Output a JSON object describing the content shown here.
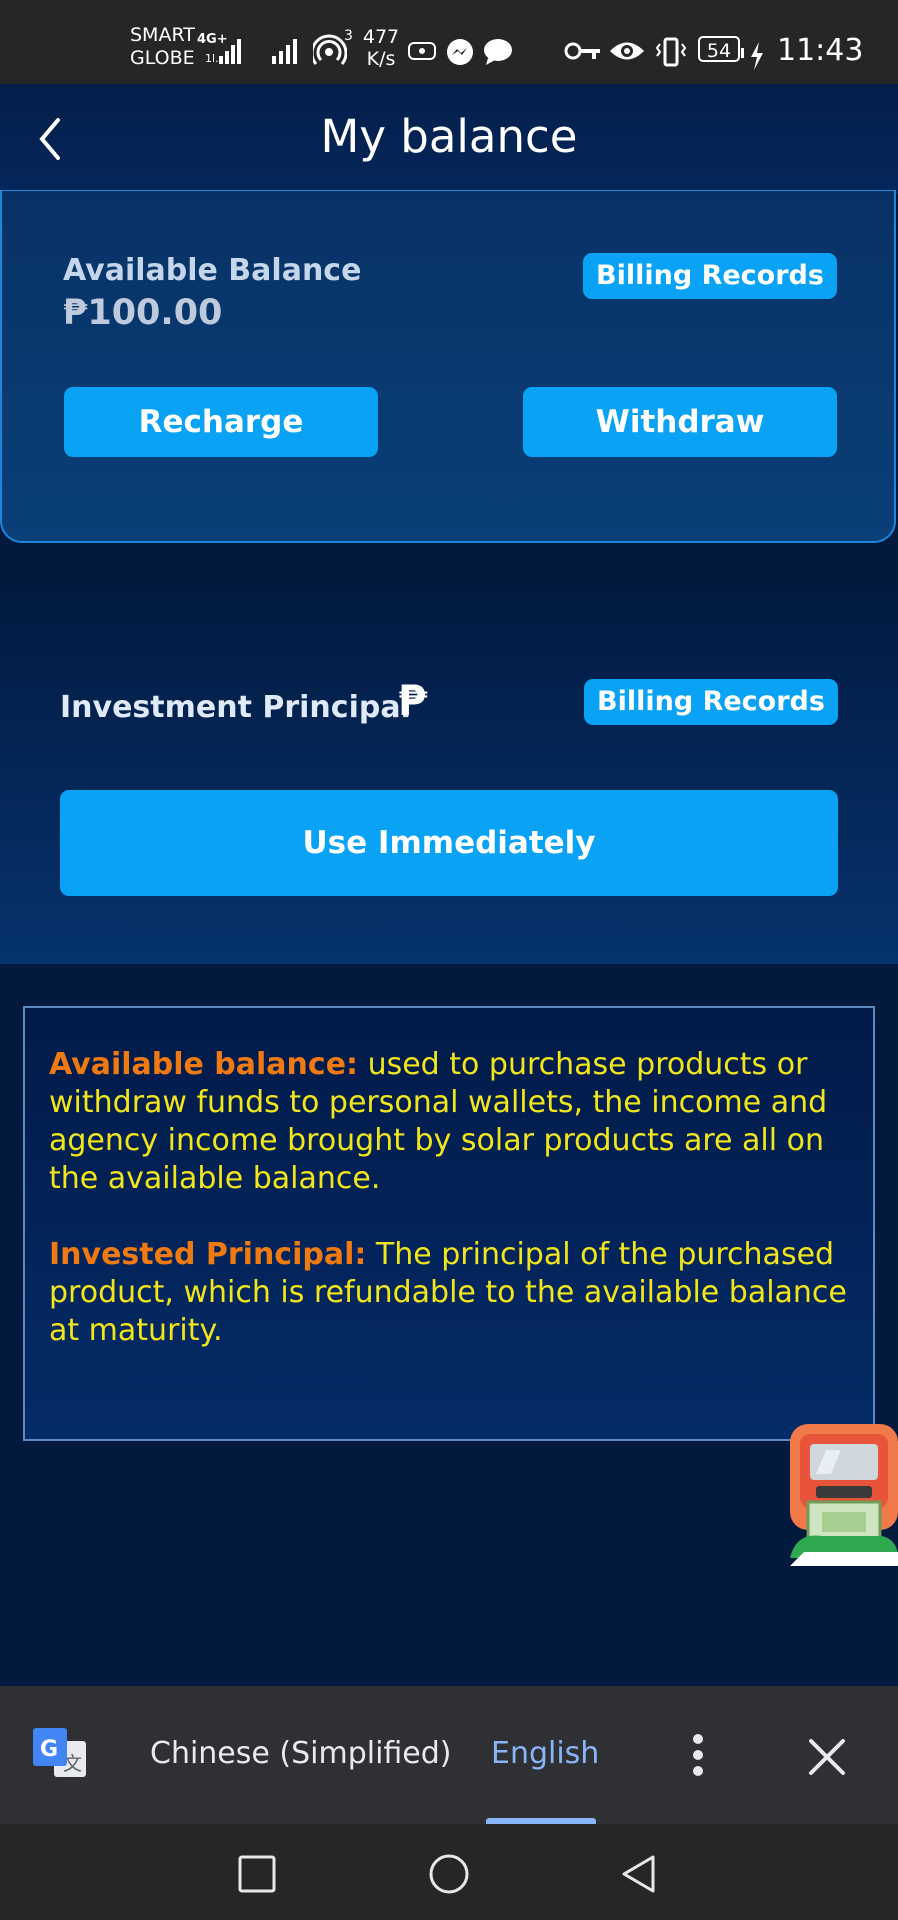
{
  "status_bar": {
    "carrier_line1": "SMART",
    "carrier_line2": "GLOBE",
    "net_type": "4G+",
    "hotspot_count": "3",
    "speed_value": "477",
    "speed_unit": "K/s",
    "battery": "54",
    "time": "11:43"
  },
  "header": {
    "title": "My balance"
  },
  "balance_card": {
    "label": "Available Balance",
    "amount": "₱100.00",
    "billing_label": "Billing Records",
    "recharge_label": "Recharge",
    "withdraw_label": "Withdraw"
  },
  "principal_card": {
    "label": "Investment Principal",
    "currency_symbol": "₱",
    "billing_label": "Billing Records",
    "use_label": "Use Immediately"
  },
  "info": {
    "item1_title": "Available balance:",
    "item1_text": " used to purchase products or withdraw funds to personal wallets, the income and agency income brought by solar products are all on the available balance.",
    "item2_title": "Invested Principal:",
    "item2_text": " The principal of the purchased product, which is refundable to the available balance at maturity."
  },
  "translate_bar": {
    "source_lang": "Chinese (Simplified)",
    "target_lang": "English"
  },
  "colors": {
    "accent_blue": "#0aa2f5",
    "highlight_orange": "#f07a12",
    "info_yellow": "#f2e51b"
  }
}
